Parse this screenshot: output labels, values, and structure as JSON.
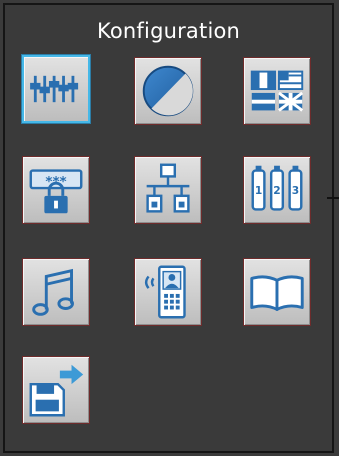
{
  "header": {
    "title": "Konfiguration"
  },
  "tiles": [
    {
      "icon": "equalizer-sliders-icon",
      "selected": true
    },
    {
      "icon": "display-contrast-icon",
      "selected": false
    },
    {
      "icon": "language-flags-icon",
      "selected": false
    },
    {
      "icon": "password-lock-icon",
      "selected": false
    },
    {
      "icon": "network-topology-icon",
      "selected": false
    },
    {
      "icon": "numbered-devices-icon",
      "selected": false
    },
    {
      "icon": "music-note-icon",
      "selected": false
    },
    {
      "icon": "intercom-doorstation-icon",
      "selected": false
    },
    {
      "icon": "open-book-icon",
      "selected": false
    },
    {
      "icon": "save-floppy-icon",
      "selected": false
    }
  ],
  "password_icon_text": "***",
  "device_labels": [
    "1",
    "2",
    "3"
  ],
  "colors": {
    "icon_blue": "#2a6fb0",
    "selected_border": "#45b8e8",
    "background": "#3a3a3a"
  }
}
